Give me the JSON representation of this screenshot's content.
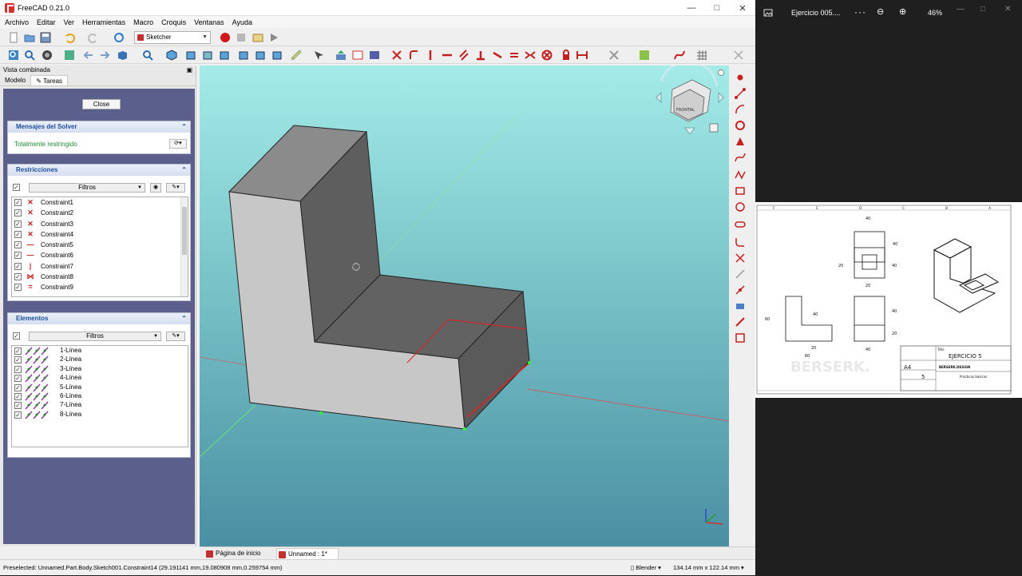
{
  "app": {
    "title": "FreeCAD 0.21.0"
  },
  "menu": [
    "Archivo",
    "Editar",
    "Ver",
    "Herramientas",
    "Macro",
    "Croquis",
    "Ventanas",
    "Ayuda"
  ],
  "toolbar": {
    "workbench": "Sketcher"
  },
  "combo": {
    "title": "Vista combinada",
    "tabs": [
      "Modelo",
      "Tareas"
    ],
    "close_label": "Close",
    "solver": {
      "title": "Mensajes del Solver",
      "message": "Totalmente restringido"
    },
    "constraints": {
      "title": "Restricciones",
      "filter_label": "Filtros",
      "items": [
        {
          "name": "Constraint1",
          "icon": "coincident-icon"
        },
        {
          "name": "Constraint2",
          "icon": "coincident-icon"
        },
        {
          "name": "Constraint3",
          "icon": "coincident-icon"
        },
        {
          "name": "Constraint4",
          "icon": "coincident-icon"
        },
        {
          "name": "Constraint5",
          "icon": "horizontal-icon"
        },
        {
          "name": "Constraint6",
          "icon": "horizontal-icon"
        },
        {
          "name": "Constraint7",
          "icon": "vertical-icon"
        },
        {
          "name": "Constraint8",
          "icon": "point-on-object-icon"
        },
        {
          "name": "Constraint9",
          "icon": "equal-icon"
        }
      ]
    },
    "elements": {
      "title": "Elementos",
      "filter_label": "Filtros",
      "items": [
        "1-Línea",
        "2-Línea",
        "3-Línea",
        "4-Línea",
        "5-Línea",
        "6-Línea",
        "7-Línea",
        "8-Línea"
      ]
    }
  },
  "viewport": {
    "navcube_face": "FRONTAL"
  },
  "doc_tabs": [
    {
      "label": "Página de inicio",
      "active": false
    },
    {
      "label": "Unnamed : 1*",
      "active": true
    }
  ],
  "status": {
    "message": "Preselected: Unnamed.Part.Body.Sketch001.Constraint14 (29.191141 mm,19.080908 mm,0.259754 mm)",
    "nav_style": "Blender",
    "dimensions": "134.14 mm x 122.14 mm"
  },
  "pdf": {
    "title": "Ejercicio 005....",
    "zoom": "46%",
    "drawing": {
      "title_label": "Title",
      "title": "EJERCICIO 5",
      "format": "A4",
      "sheet_number": "5",
      "brand": "BERSERK.DESIGN",
      "category": "Prácticas básicas",
      "dims": [
        "40",
        "20",
        "40",
        "20",
        "60",
        "40",
        "20",
        "40",
        "20",
        "40",
        "60",
        "40"
      ],
      "col_labels": [
        "F",
        "E",
        "D",
        "C",
        "B",
        "A"
      ]
    }
  },
  "colors": {
    "accent_blue": "#1d4f9c",
    "solver_green": "#1e8a2e",
    "constraint_red": "#c02020",
    "task_bg": "#5b5f8c"
  }
}
